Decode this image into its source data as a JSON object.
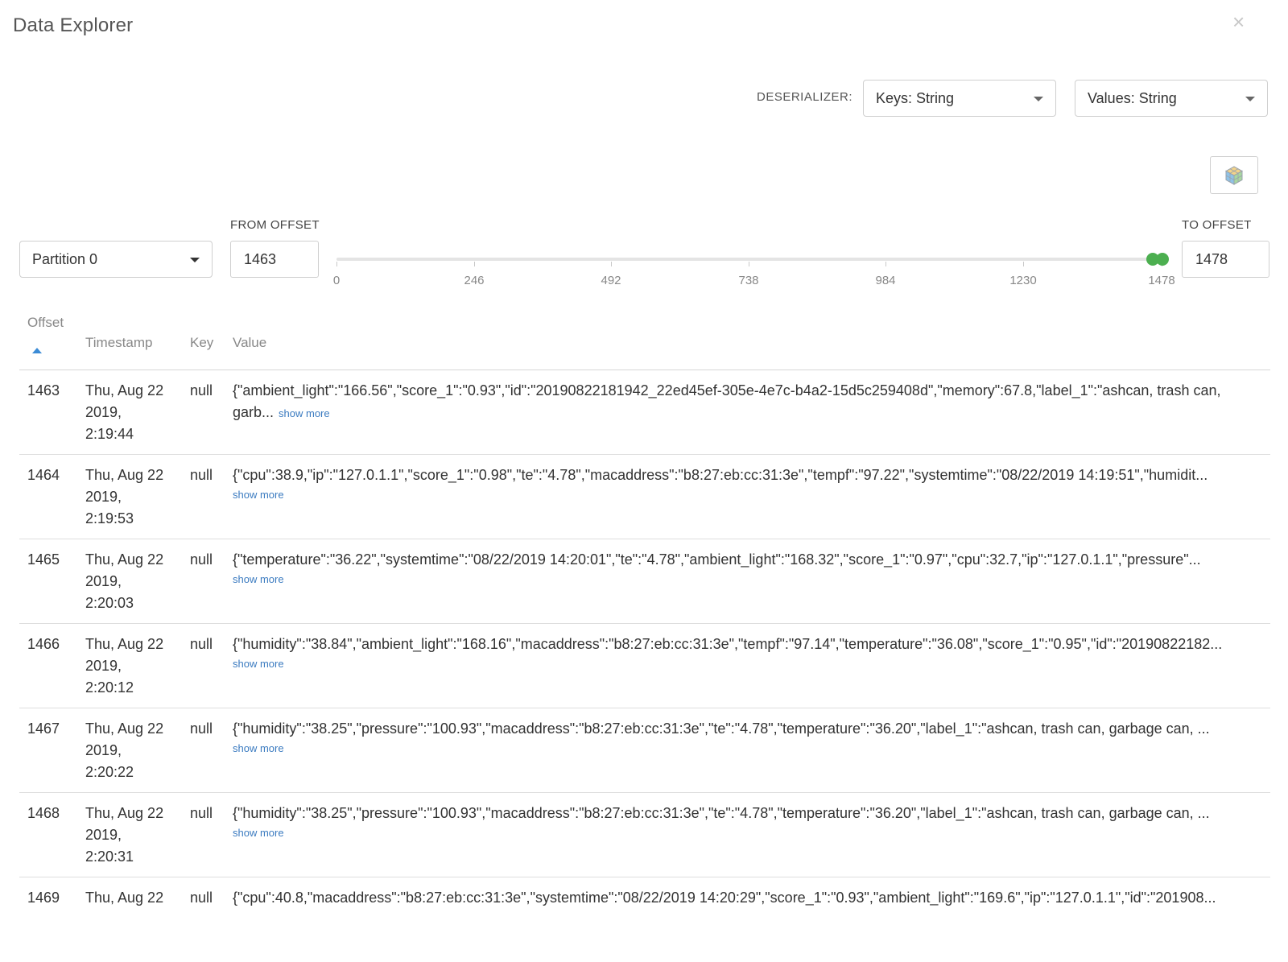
{
  "title": "Data Explorer",
  "close_glyph": "×",
  "deserializer": {
    "label": "DESERIALIZER:",
    "keys": "Keys: String",
    "values": "Values: String"
  },
  "cube_icon": "cube-icon",
  "partition": {
    "selected": "Partition 0"
  },
  "offsets": {
    "from_label": "FROM OFFSET",
    "from_value": "1463",
    "to_label": "TO OFFSET",
    "to_value": "1478"
  },
  "slider": {
    "min": 0,
    "max": 1478,
    "range_start": 1463,
    "range_end": 1478,
    "ticks": [
      "0",
      "246",
      "492",
      "738",
      "984",
      "1230",
      "1478"
    ],
    "accent": "#4caf50"
  },
  "table": {
    "headers": {
      "offset": "Offset",
      "timestamp": "Timestamp",
      "key": "Key",
      "value": "Value"
    },
    "show_more": "show more",
    "rows": [
      {
        "offset": "1463",
        "ts_date": "Thu, Aug 22",
        "ts_year": "2019,",
        "ts_time": "2:19:44",
        "key": "null",
        "value": "{\"ambient_light\":\"166.56\",\"score_1\":\"0.93\",\"id\":\"20190822181942_22ed45ef-305e-4e7c-b4a2-15d5c259408d\",\"memory\":67.8,\"label_1\":\"ashcan, trash can, garb..."
      },
      {
        "offset": "1464",
        "ts_date": "Thu, Aug 22",
        "ts_year": "2019,",
        "ts_time": "2:19:53",
        "key": "null",
        "value": "{\"cpu\":38.9,\"ip\":\"127.0.1.1\",\"score_1\":\"0.98\",\"te\":\"4.78\",\"macaddress\":\"b8:27:eb:cc:31:3e\",\"tempf\":\"97.22\",\"systemtime\":\"08/22/2019 14:19:51\",\"humidit..."
      },
      {
        "offset": "1465",
        "ts_date": "Thu, Aug 22",
        "ts_year": "2019,",
        "ts_time": "2:20:03",
        "key": "null",
        "value": "{\"temperature\":\"36.22\",\"systemtime\":\"08/22/2019 14:20:01\",\"te\":\"4.78\",\"ambient_light\":\"168.32\",\"score_1\":\"0.97\",\"cpu\":32.7,\"ip\":\"127.0.1.1\",\"pressure\"..."
      },
      {
        "offset": "1466",
        "ts_date": "Thu, Aug 22",
        "ts_year": "2019,",
        "ts_time": "2:20:12",
        "key": "null",
        "value": "{\"humidity\":\"38.84\",\"ambient_light\":\"168.16\",\"macaddress\":\"b8:27:eb:cc:31:3e\",\"tempf\":\"97.14\",\"temperature\":\"36.08\",\"score_1\":\"0.95\",\"id\":\"20190822182..."
      },
      {
        "offset": "1467",
        "ts_date": "Thu, Aug 22",
        "ts_year": "2019,",
        "ts_time": "2:20:22",
        "key": "null",
        "value": "{\"humidity\":\"38.25\",\"pressure\":\"100.93\",\"macaddress\":\"b8:27:eb:cc:31:3e\",\"te\":\"4.78\",\"temperature\":\"36.20\",\"label_1\":\"ashcan, trash can, garbage can, ..."
      },
      {
        "offset": "1468",
        "ts_date": "Thu, Aug 22",
        "ts_year": "2019,",
        "ts_time": "2:20:31",
        "key": "null",
        "value": "{\"humidity\":\"38.25\",\"pressure\":\"100.93\",\"macaddress\":\"b8:27:eb:cc:31:3e\",\"te\":\"4.78\",\"temperature\":\"36.20\",\"label_1\":\"ashcan, trash can, garbage can, ..."
      },
      {
        "offset": "1469",
        "ts_date": "Thu, Aug 22",
        "ts_year": "",
        "ts_time": "",
        "key": "null",
        "value": "{\"cpu\":40.8,\"macaddress\":\"b8:27:eb:cc:31:3e\",\"systemtime\":\"08/22/2019 14:20:29\",\"score_1\":\"0.93\",\"ambient_light\":\"169.6\",\"ip\":\"127.0.1.1\",\"id\":\"201908..."
      }
    ]
  }
}
